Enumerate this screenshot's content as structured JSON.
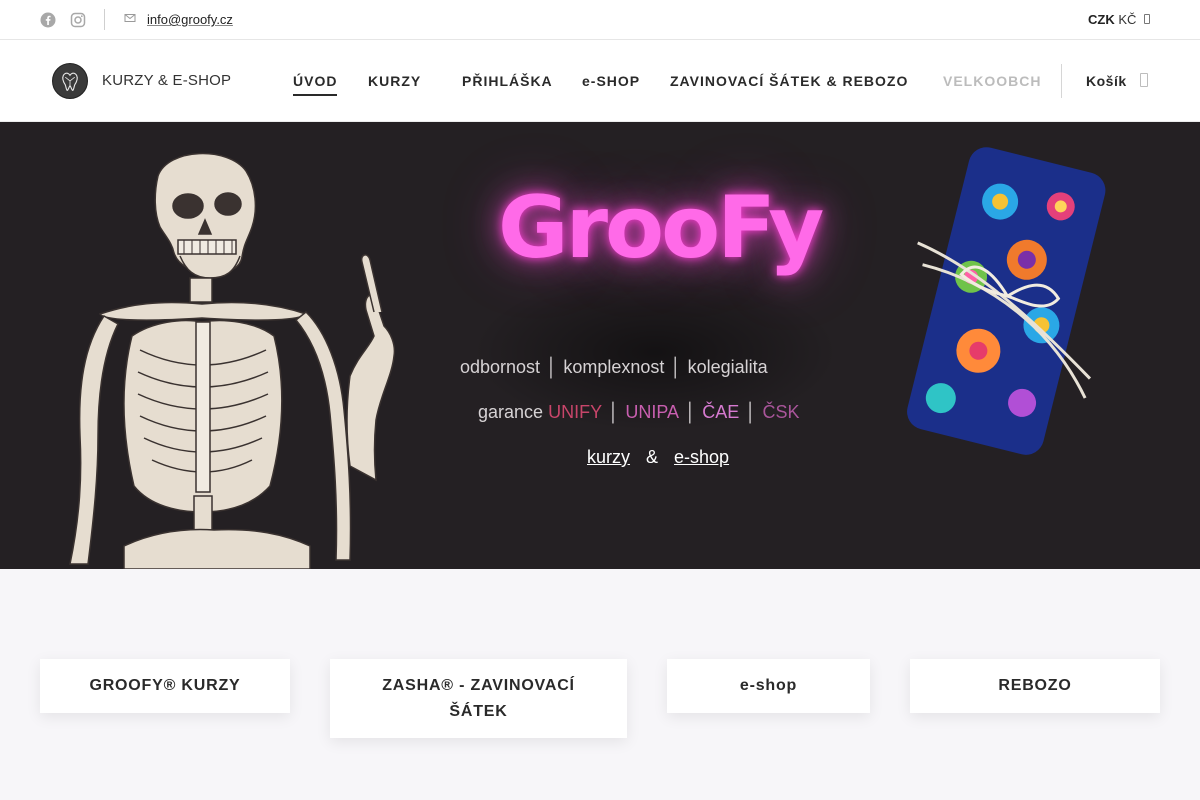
{
  "topbar": {
    "email": "info@groofy.cz",
    "currency_code": "CZK",
    "currency_symbol": "KČ",
    "icons": [
      "facebook-icon",
      "instagram-icon",
      "mail-icon",
      "chevron-down-icon"
    ]
  },
  "header": {
    "logo_text": "KURZY & E-SHOP",
    "nav": [
      {
        "label": "ÚVOD",
        "active": true
      },
      {
        "label": "KURZY"
      },
      {
        "label": "PŘIHLÁŠKA"
      },
      {
        "label": "e-SHOP"
      },
      {
        "label": "ZAVINOVACÍ ŠÁTEK & REBOZO"
      },
      {
        "label": "VELKOOBCH"
      }
    ],
    "cart_label": "Košík"
  },
  "hero": {
    "brand": "GrooFy",
    "tagline": [
      "odbornost",
      "komplexnost",
      "kolegialita"
    ],
    "garance_label": "garance",
    "garance": [
      {
        "label": "UNIFY",
        "color": "#c8456a"
      },
      {
        "label": "UNIPA",
        "color": "#c95fb0"
      },
      {
        "label": "ČAE",
        "color": "#d67ad0"
      },
      {
        "label": "ČSK",
        "color": "#a9559a"
      }
    ],
    "link_kurzy": "kurzy",
    "amp": "&",
    "link_eshop": "e-shop",
    "colors": {
      "background": "#242023",
      "neon": "#ff6ae8"
    }
  },
  "categories": [
    {
      "label": "GROOFY® KURZY"
    },
    {
      "label": "ZASHA® - ZAVINOVACÍ ŠÁTEK"
    },
    {
      "label": "e-shop"
    },
    {
      "label": "REBOZO"
    }
  ]
}
